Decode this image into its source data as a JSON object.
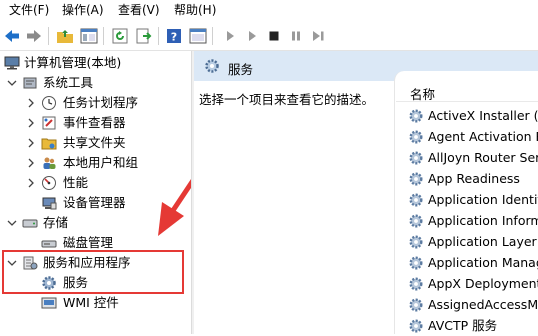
{
  "menu": {
    "file": "文件(F)",
    "action": "操作(A)",
    "view": "查看(V)",
    "help": "帮助(H)"
  },
  "toolbar": {
    "icons": [
      "back-arrow-icon",
      "forward-arrow-icon",
      "up-folder-icon",
      "show-hide-tree-icon",
      "refresh-icon",
      "export-list-icon",
      "help-icon",
      "properties-icon",
      "start-service-icon",
      "start-service-alt-icon",
      "stop-service-icon",
      "pause-service-icon",
      "restart-service-icon"
    ]
  },
  "tree": {
    "root": "计算机管理(本地)",
    "system_tools": "系统工具",
    "task_scheduler": "任务计划程序",
    "event_viewer": "事件查看器",
    "shared_folders": "共享文件夹",
    "local_users": "本地用户和组",
    "performance": "性能",
    "device_manager": "设备管理器",
    "storage": "存储",
    "disk_management": "磁盘管理",
    "services_apps": "服务和应用程序",
    "services": "服务",
    "wmi": "WMI 控件"
  },
  "main": {
    "header": "服务",
    "description": "选择一个项目来查看它的描述。",
    "column_name": "名称",
    "services": [
      "ActiveX Installer (AxInstSV)",
      "Agent Activation Runtime",
      "AllJoyn Router Service",
      "App Readiness",
      "Application Identity",
      "Application Information",
      "Application Layer Gateway Service",
      "Application Management",
      "AppX Deployment Service",
      "AssignedAccessManager",
      "AVCTP 服务"
    ]
  },
  "colors": {
    "highlight": "#e53935",
    "header_bg": "#dbe8f6",
    "toolbar_blue": "#1e6fc8"
  }
}
